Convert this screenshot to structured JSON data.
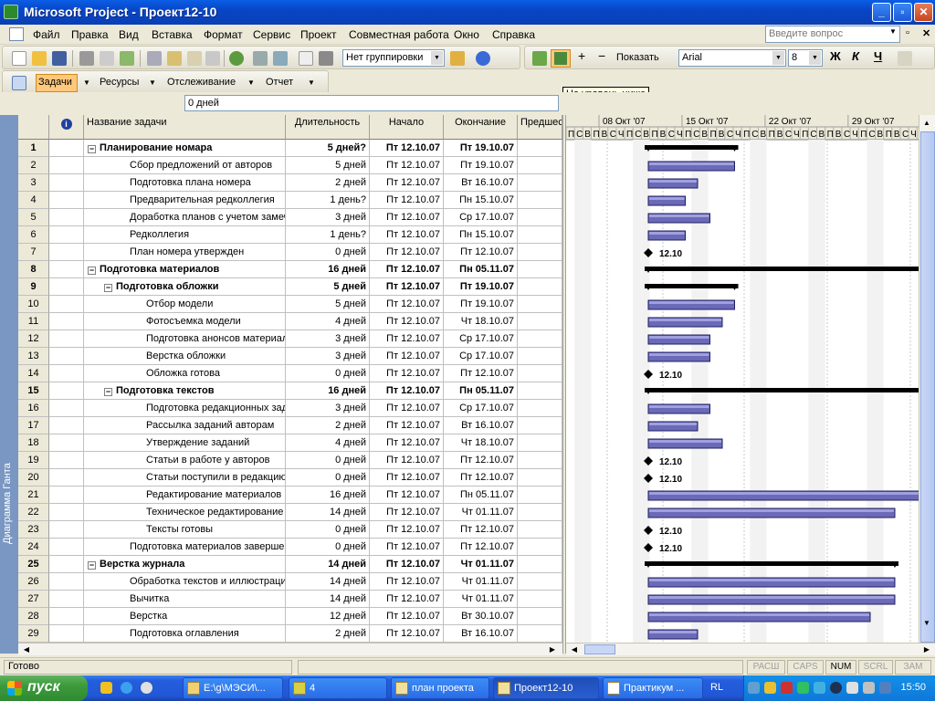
{
  "window": {
    "title": "Microsoft Project - Проект12-10",
    "minimize": "_",
    "maximize": "▫",
    "close": "✕"
  },
  "menu": [
    "Файл",
    "Правка",
    "Вид",
    "Вставка",
    "Формат",
    "Сервис",
    "Проект",
    "Совместная работа",
    "Окно",
    "Справка"
  ],
  "ask_placeholder": "Введите вопрос",
  "toolbar": {
    "grouping": "Нет группировки",
    "show_label": "Показать",
    "font": "Arial",
    "font_size": "8",
    "bold": "Ж",
    "italic": "К",
    "underline": "Ч"
  },
  "guide_toolbar": {
    "tasks": "Задачи",
    "resources": "Ресурсы",
    "tracking": "Отслеживание",
    "report": "Отчет"
  },
  "tooltip": "На уровень ниже",
  "entry_value": "0 дней",
  "view_bar_label": "Диаграмма Ганта",
  "columns": {
    "info": "i",
    "name": "Название задачи",
    "duration": "Длительность",
    "start": "Начало",
    "finish": "Окончание",
    "pred": "Предшес"
  },
  "timescale": {
    "weeks": [
      "08 Окт '07",
      "15 Окт '07",
      "22 Окт '07",
      "29 Окт '07"
    ],
    "days": [
      "П",
      "С",
      "В",
      "П",
      "В",
      "С",
      "Ч",
      "П",
      "С",
      "В",
      "П",
      "В",
      "С",
      "Ч",
      "П",
      "С",
      "В",
      "П",
      "В",
      "С",
      "Ч",
      "П",
      "С",
      "В",
      "П",
      "В",
      "С",
      "Ч",
      "П",
      "С",
      "В",
      "П",
      "В",
      "С",
      "Ч",
      "П",
      "С",
      "В",
      "П",
      "В",
      "С",
      "Ч",
      "П",
      "С"
    ]
  },
  "tasks": [
    {
      "id": "1",
      "level": 0,
      "summary": true,
      "name": "Планирование номара",
      "duration": "5 дней?",
      "start": "Пт 12.10.07",
      "finish": "Пт 19.10.07",
      "bar": [
        0,
        7
      ],
      "type": "summary"
    },
    {
      "id": "2",
      "level": 1,
      "summary": false,
      "name": "Сбор предложений от авторов",
      "duration": "5 дней",
      "start": "Пт 12.10.07",
      "finish": "Пт 19.10.07",
      "bar": [
        0,
        7
      ],
      "type": "task"
    },
    {
      "id": "3",
      "level": 1,
      "summary": false,
      "name": "Подготовка плана номера",
      "duration": "2 дней",
      "start": "Пт 12.10.07",
      "finish": "Вт 16.10.07",
      "bar": [
        0,
        4
      ],
      "type": "task"
    },
    {
      "id": "4",
      "level": 1,
      "summary": false,
      "name": "Предварительная редколлегия",
      "duration": "1 день?",
      "start": "Пт 12.10.07",
      "finish": "Пн 15.10.07",
      "bar": [
        0,
        3
      ],
      "type": "task"
    },
    {
      "id": "5",
      "level": 1,
      "summary": false,
      "name": "Доработка планов с учетом замечаний",
      "duration": "3 дней",
      "start": "Пт 12.10.07",
      "finish": "Ср 17.10.07",
      "bar": [
        0,
        5
      ],
      "type": "task"
    },
    {
      "id": "6",
      "level": 1,
      "summary": false,
      "name": "Редколлегия",
      "duration": "1 день?",
      "start": "Пт 12.10.07",
      "finish": "Пн 15.10.07",
      "bar": [
        0,
        3
      ],
      "type": "task"
    },
    {
      "id": "7",
      "level": 1,
      "summary": false,
      "name": "План номера утвержден",
      "duration": "0 дней",
      "start": "Пт 12.10.07",
      "finish": "Пт 12.10.07",
      "type": "milestone",
      "label": "12.10"
    },
    {
      "id": "8",
      "level": 0,
      "summary": true,
      "name": "Подготовка материалов",
      "duration": "16 дней",
      "start": "Пт 12.10.07",
      "finish": "Пн 05.11.07",
      "bar": [
        0,
        24
      ],
      "type": "summary"
    },
    {
      "id": "9",
      "level": 1,
      "summary": true,
      "name": "Подготовка обложки",
      "duration": "5 дней",
      "start": "Пт 12.10.07",
      "finish": "Пт 19.10.07",
      "bar": [
        0,
        7
      ],
      "type": "summary"
    },
    {
      "id": "10",
      "level": 2,
      "summary": false,
      "name": "Отбор модели",
      "duration": "5 дней",
      "start": "Пт 12.10.07",
      "finish": "Пт 19.10.07",
      "bar": [
        0,
        7
      ],
      "type": "task"
    },
    {
      "id": "11",
      "level": 2,
      "summary": false,
      "name": "Фотосъемка модели",
      "duration": "4 дней",
      "start": "Пт 12.10.07",
      "finish": "Чт 18.10.07",
      "bar": [
        0,
        6
      ],
      "type": "task"
    },
    {
      "id": "12",
      "level": 2,
      "summary": false,
      "name": "Подготовка анонсов материалов",
      "duration": "3 дней",
      "start": "Пт 12.10.07",
      "finish": "Ср 17.10.07",
      "bar": [
        0,
        5
      ],
      "type": "task"
    },
    {
      "id": "13",
      "level": 2,
      "summary": false,
      "name": "Верстка обложки",
      "duration": "3 дней",
      "start": "Пт 12.10.07",
      "finish": "Ср 17.10.07",
      "bar": [
        0,
        5
      ],
      "type": "task"
    },
    {
      "id": "14",
      "level": 2,
      "summary": false,
      "name": "Обложка готова",
      "duration": "0 дней",
      "start": "Пт 12.10.07",
      "finish": "Пт 12.10.07",
      "type": "milestone",
      "label": "12.10"
    },
    {
      "id": "15",
      "level": 1,
      "summary": true,
      "name": "Подготовка текстов",
      "duration": "16 дней",
      "start": "Пт 12.10.07",
      "finish": "Пн 05.11.07",
      "bar": [
        0,
        24
      ],
      "type": "summary"
    },
    {
      "id": "16",
      "level": 2,
      "summary": false,
      "name": "Подготовка редакционных заданий",
      "duration": "3 дней",
      "start": "Пт 12.10.07",
      "finish": "Ср 17.10.07",
      "bar": [
        0,
        5
      ],
      "type": "task"
    },
    {
      "id": "17",
      "level": 2,
      "summary": false,
      "name": "Рассылка заданий авторам",
      "duration": "2 дней",
      "start": "Пт 12.10.07",
      "finish": "Вт 16.10.07",
      "bar": [
        0,
        4
      ],
      "type": "task"
    },
    {
      "id": "18",
      "level": 2,
      "summary": false,
      "name": "Утверждение заданий",
      "duration": "4 дней",
      "start": "Пт 12.10.07",
      "finish": "Чт 18.10.07",
      "bar": [
        0,
        6
      ],
      "type": "task"
    },
    {
      "id": "19",
      "level": 2,
      "summary": false,
      "name": "Статьи в работе у авторов",
      "duration": "0 дней",
      "start": "Пт 12.10.07",
      "finish": "Пт 12.10.07",
      "type": "milestone",
      "label": "12.10"
    },
    {
      "id": "20",
      "level": 2,
      "summary": false,
      "name": "Статьи поступили в редакцию",
      "duration": "0 дней",
      "start": "Пт 12.10.07",
      "finish": "Пт 12.10.07",
      "type": "milestone",
      "label": "12.10"
    },
    {
      "id": "21",
      "level": 2,
      "summary": false,
      "name": "Редактирование материалов",
      "duration": "16 дней",
      "start": "Пт 12.10.07",
      "finish": "Пн 05.11.07",
      "bar": [
        0,
        24
      ],
      "type": "task"
    },
    {
      "id": "22",
      "level": 2,
      "summary": false,
      "name": "Техническое редактирование",
      "duration": "14 дней",
      "start": "Пт 12.10.07",
      "finish": "Чт 01.11.07",
      "bar": [
        0,
        20
      ],
      "type": "task"
    },
    {
      "id": "23",
      "level": 2,
      "summary": false,
      "name": "Тексты готовы",
      "duration": "0 дней",
      "start": "Пт 12.10.07",
      "finish": "Пт 12.10.07",
      "type": "milestone",
      "label": "12.10"
    },
    {
      "id": "24",
      "level": 1,
      "summary": false,
      "name": "Подготовка материалов завершена",
      "duration": "0 дней",
      "start": "Пт 12.10.07",
      "finish": "Пт 12.10.07",
      "type": "milestone",
      "label": "12.10"
    },
    {
      "id": "25",
      "level": 0,
      "summary": true,
      "name": "Верстка журнала",
      "duration": "14 дней",
      "start": "Пт 12.10.07",
      "finish": "Чт 01.11.07",
      "bar": [
        0,
        20
      ],
      "type": "summary"
    },
    {
      "id": "26",
      "level": 1,
      "summary": false,
      "name": "Обработка текстов и иллюстраций",
      "duration": "14 дней",
      "start": "Пт 12.10.07",
      "finish": "Чт 01.11.07",
      "bar": [
        0,
        20
      ],
      "type": "task"
    },
    {
      "id": "27",
      "level": 1,
      "summary": false,
      "name": "Вычитка",
      "duration": "14 дней",
      "start": "Пт 12.10.07",
      "finish": "Чт 01.11.07",
      "bar": [
        0,
        20
      ],
      "type": "task"
    },
    {
      "id": "28",
      "level": 1,
      "summary": false,
      "name": "Верстка",
      "duration": "12 дней",
      "start": "Пт 12.10.07",
      "finish": "Вт 30.10.07",
      "bar": [
        0,
        18
      ],
      "type": "task"
    },
    {
      "id": "29",
      "level": 1,
      "summary": false,
      "name": "Подготовка оглавления",
      "duration": "2 дней",
      "start": "Пт 12.10.07",
      "finish": "Вт 16.10.07",
      "bar": [
        0,
        4
      ],
      "type": "task"
    }
  ],
  "status": {
    "text": "Готово",
    "indicators": [
      {
        "label": "РАСШ",
        "on": false
      },
      {
        "label": "CAPS",
        "on": false
      },
      {
        "label": "NUM",
        "on": true
      },
      {
        "label": "SCRL",
        "on": false
      },
      {
        "label": "ЗАМ",
        "on": false
      }
    ]
  },
  "taskbar": {
    "start": "пуск",
    "items": [
      "E:\\g\\МЭСИ\\...",
      "4",
      "план проекта",
      "Проект12-10",
      "Практикум ..."
    ],
    "lang": "RL",
    "clock": "15:50"
  }
}
